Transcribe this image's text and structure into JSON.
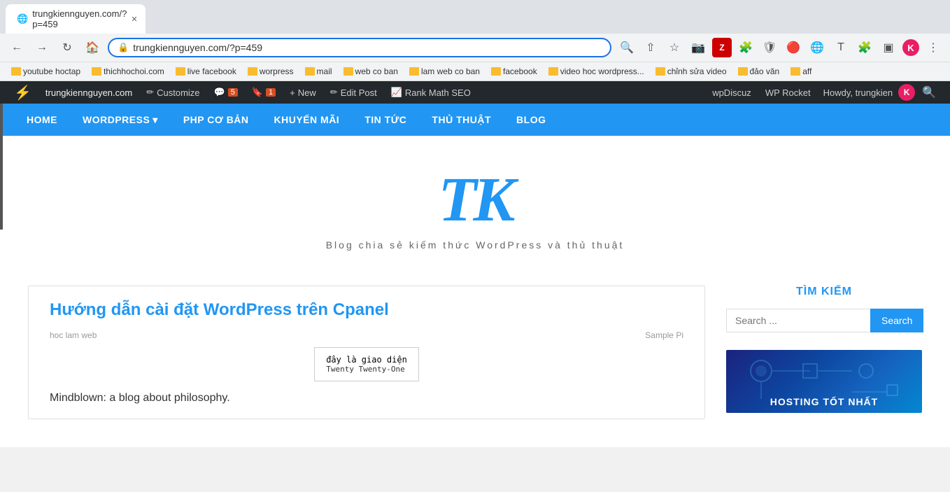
{
  "browser": {
    "url": "trungkiennguyen.com/?p=459",
    "tab_title": "trungkiennguyen.com/?p=459"
  },
  "bookmarks": [
    {
      "label": "youtube hoctap",
      "type": "folder"
    },
    {
      "label": "thichhochoi.com",
      "type": "folder"
    },
    {
      "label": "live facebook",
      "type": "folder"
    },
    {
      "label": "worpress",
      "type": "folder"
    },
    {
      "label": "mail",
      "type": "folder"
    },
    {
      "label": "web co ban",
      "type": "folder"
    },
    {
      "label": "lam web co ban",
      "type": "folder"
    },
    {
      "label": "facebook",
      "type": "folder"
    },
    {
      "label": "video hoc wordpress...",
      "type": "folder"
    },
    {
      "label": "chỉnh sửa video",
      "type": "folder"
    },
    {
      "label": "đảo văn",
      "type": "folder"
    },
    {
      "label": "aff",
      "type": "folder"
    }
  ],
  "wp_admin_bar": {
    "wp_icon": "⚡",
    "site_name": "trungkiennguyen.com",
    "customize_label": "Customize",
    "comments_count": "5",
    "bookmark_count": "1",
    "new_label": "New",
    "edit_post_label": "Edit Post",
    "rank_math_label": "Rank Math SEO",
    "wp_discuz_label": "wpDiscuz",
    "wp_rocket_label": "WP Rocket",
    "howdy_text": "Howdy, trungkien",
    "avatar_letter": "K"
  },
  "site_nav": {
    "items": [
      {
        "label": "HOME",
        "has_dropdown": false
      },
      {
        "label": "WORDPRESS",
        "has_dropdown": true
      },
      {
        "label": "PHP CƠ BẢN",
        "has_dropdown": false
      },
      {
        "label": "KHUYẾN MÃI",
        "has_dropdown": false
      },
      {
        "label": "TIN TỨC",
        "has_dropdown": false
      },
      {
        "label": "THỦ THUẬT",
        "has_dropdown": false
      },
      {
        "label": "BLOG",
        "has_dropdown": false
      }
    ]
  },
  "site_header": {
    "logo": "TK",
    "tagline": "Blog chia sẻ kiếm thức WordPress và thủ thuật"
  },
  "post": {
    "title": "Hướng dẫn cài đặt WordPress trên Cpanel",
    "meta_left": "hoc lam web",
    "meta_right": "Sample Pi",
    "tooltip_line1": "đây là giao diện",
    "tooltip_line2": "Twenty Twenty-One",
    "excerpt": "Mindblown: a blog about philosophy."
  },
  "sidebar": {
    "search_widget": {
      "title": "TÌM KIẾM",
      "placeholder": "Search ...",
      "button_label": "Search"
    },
    "hosting_image": {
      "text": "HOSTING TỐT NHẤT"
    }
  }
}
